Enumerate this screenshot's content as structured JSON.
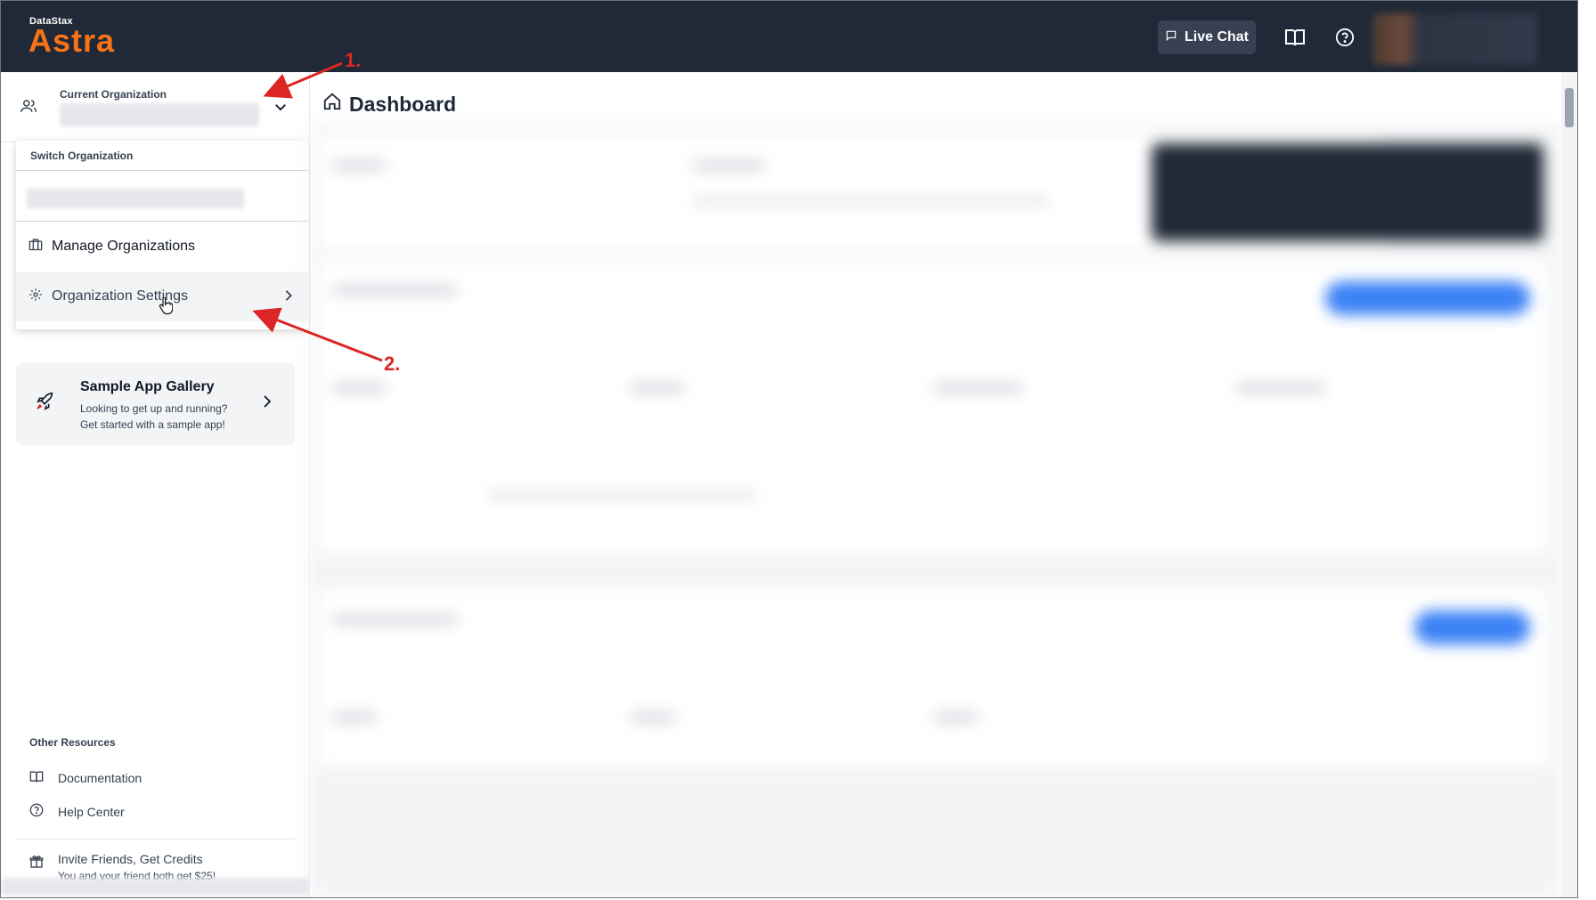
{
  "brand": {
    "small": "DataStax",
    "name": "Astra",
    "accent": "#f97316"
  },
  "topbar": {
    "live_chat": "Live Chat",
    "icons": [
      "chat-icon",
      "book-icon",
      "help-icon"
    ]
  },
  "sidebar": {
    "current_org_label": "Current Organization",
    "dropdown": {
      "heading": "Switch Organization",
      "items": [
        {
          "label": "Manage Organizations",
          "icon": "briefcase-icon"
        },
        {
          "label": "Organization Settings",
          "icon": "gear-icon"
        }
      ]
    },
    "sample_app": {
      "title": "Sample App Gallery",
      "line1": "Looking to get up and running?",
      "line2": "Get started with a sample app!"
    },
    "other_resources": {
      "heading": "Other Resources",
      "items": [
        {
          "label": "Documentation",
          "icon": "book-icon"
        },
        {
          "label": "Help Center",
          "icon": "help-icon"
        }
      ]
    },
    "invite": {
      "title": "Invite Friends, Get Credits",
      "subtitle": "You and your friend both get $25!"
    }
  },
  "main": {
    "title": "Dashboard"
  },
  "annotations": {
    "step1": "1.",
    "step2": "2.",
    "color": "#dc2626"
  }
}
